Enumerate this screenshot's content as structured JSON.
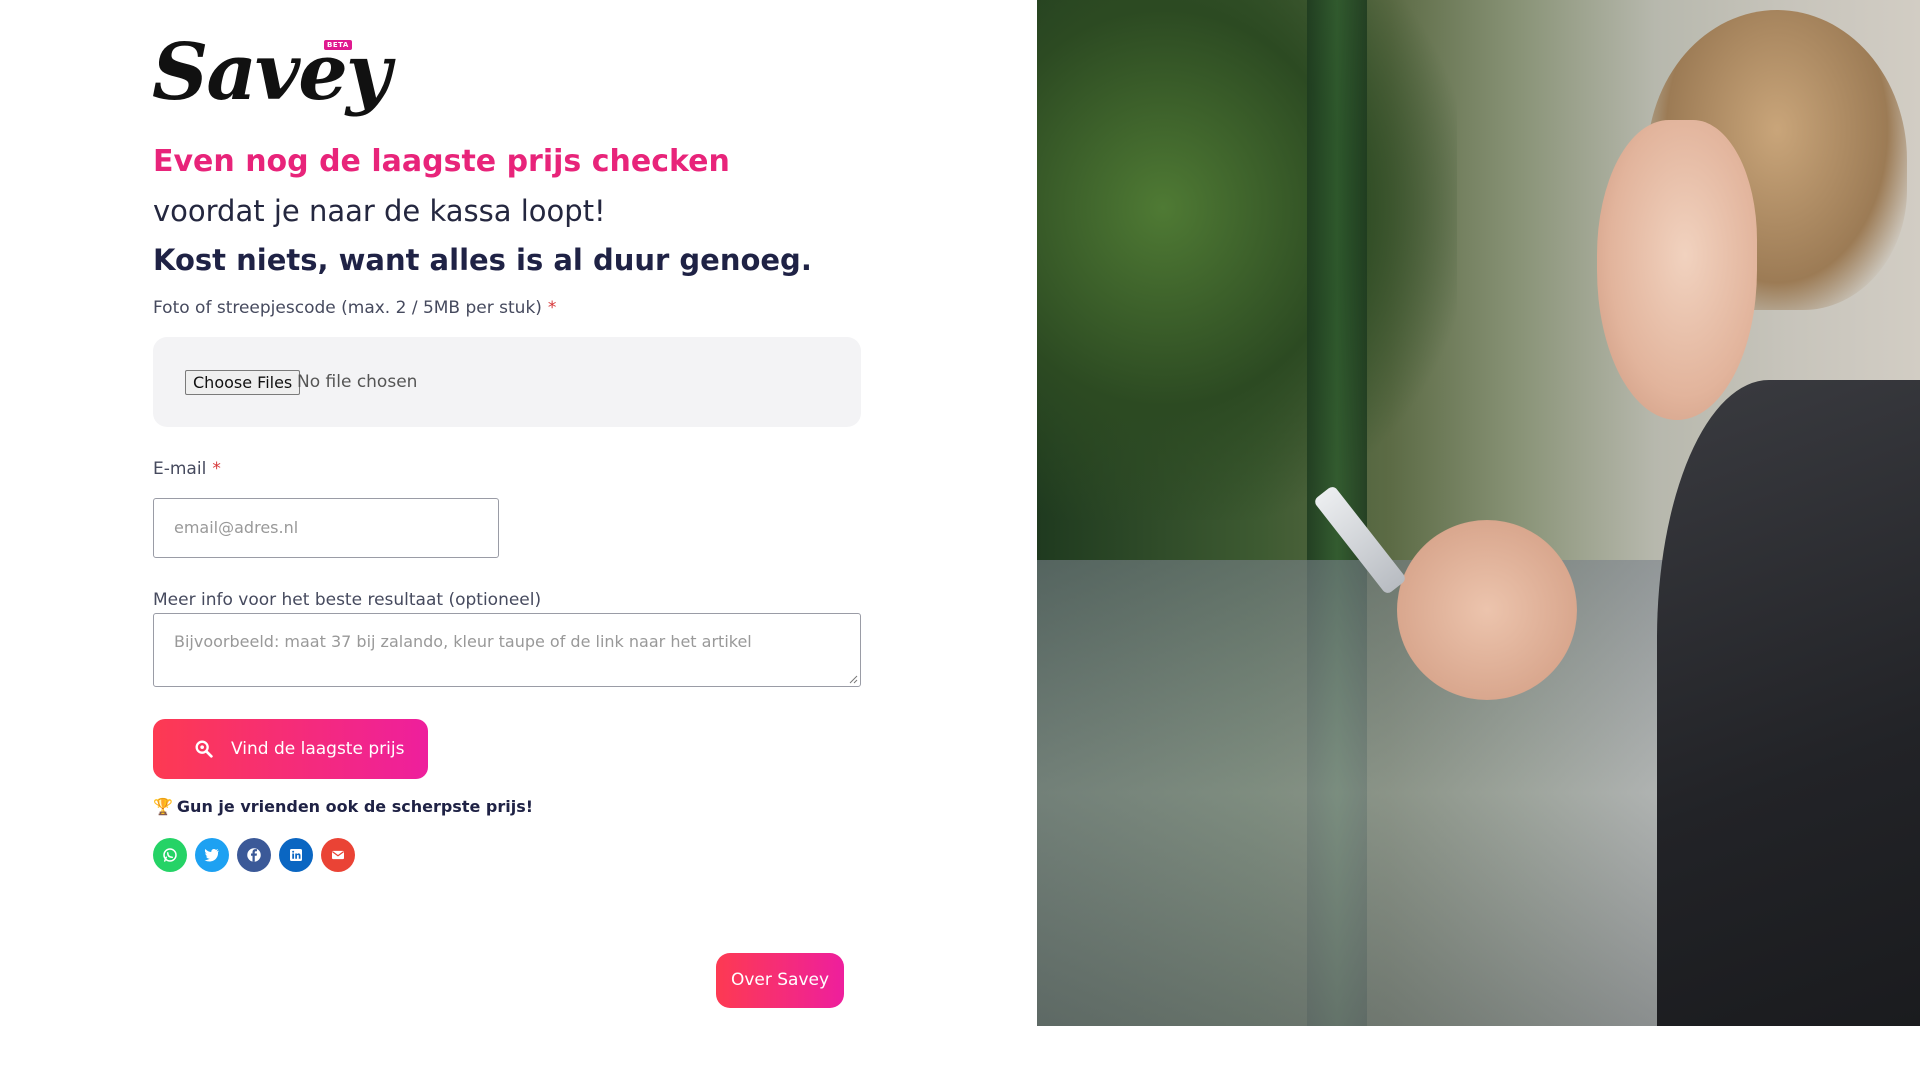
{
  "brand": {
    "logo_text": "Savey",
    "badge": "BETA"
  },
  "headline": {
    "pink": "Even nog de laagste prijs checken",
    "sub": "voordat je naar de kassa loopt!",
    "bold": "Kost niets, want alles is al duur genoeg."
  },
  "form": {
    "file_label": "Foto of streepjescode (max. 2 / 5MB per stuk)",
    "required_mark": "*",
    "choose_files_label": "Choose Files",
    "no_file_text": "No file chosen",
    "email_label": "E-mail",
    "email_placeholder": "email@adres.nl",
    "info_label": "Meer info voor het beste resultaat (optioneel)",
    "info_placeholder": "Bijvoorbeeld: maat 37 bij zalando, kleur taupe of de link naar het artikel",
    "submit_label": "Vind de laagste prijs"
  },
  "share": {
    "trophy": "🏆",
    "text": "Gun je vrienden ook de scherpste prijs!",
    "icons": [
      {
        "name": "whatsapp-icon",
        "color": "#25d366"
      },
      {
        "name": "twitter-icon",
        "color": "#1da1f2"
      },
      {
        "name": "facebook-icon",
        "color": "#3b5998"
      },
      {
        "name": "linkedin-icon",
        "color": "#0a66c2"
      },
      {
        "name": "email-icon",
        "color": "#ea4335"
      }
    ]
  },
  "footer": {
    "about_label": "Over Savey"
  },
  "colors": {
    "accent_pink": "#e8247a",
    "button_gradient_start": "#fd3a52",
    "button_gradient_end": "#ee1f9d",
    "heading_dark": "#1f2245"
  }
}
